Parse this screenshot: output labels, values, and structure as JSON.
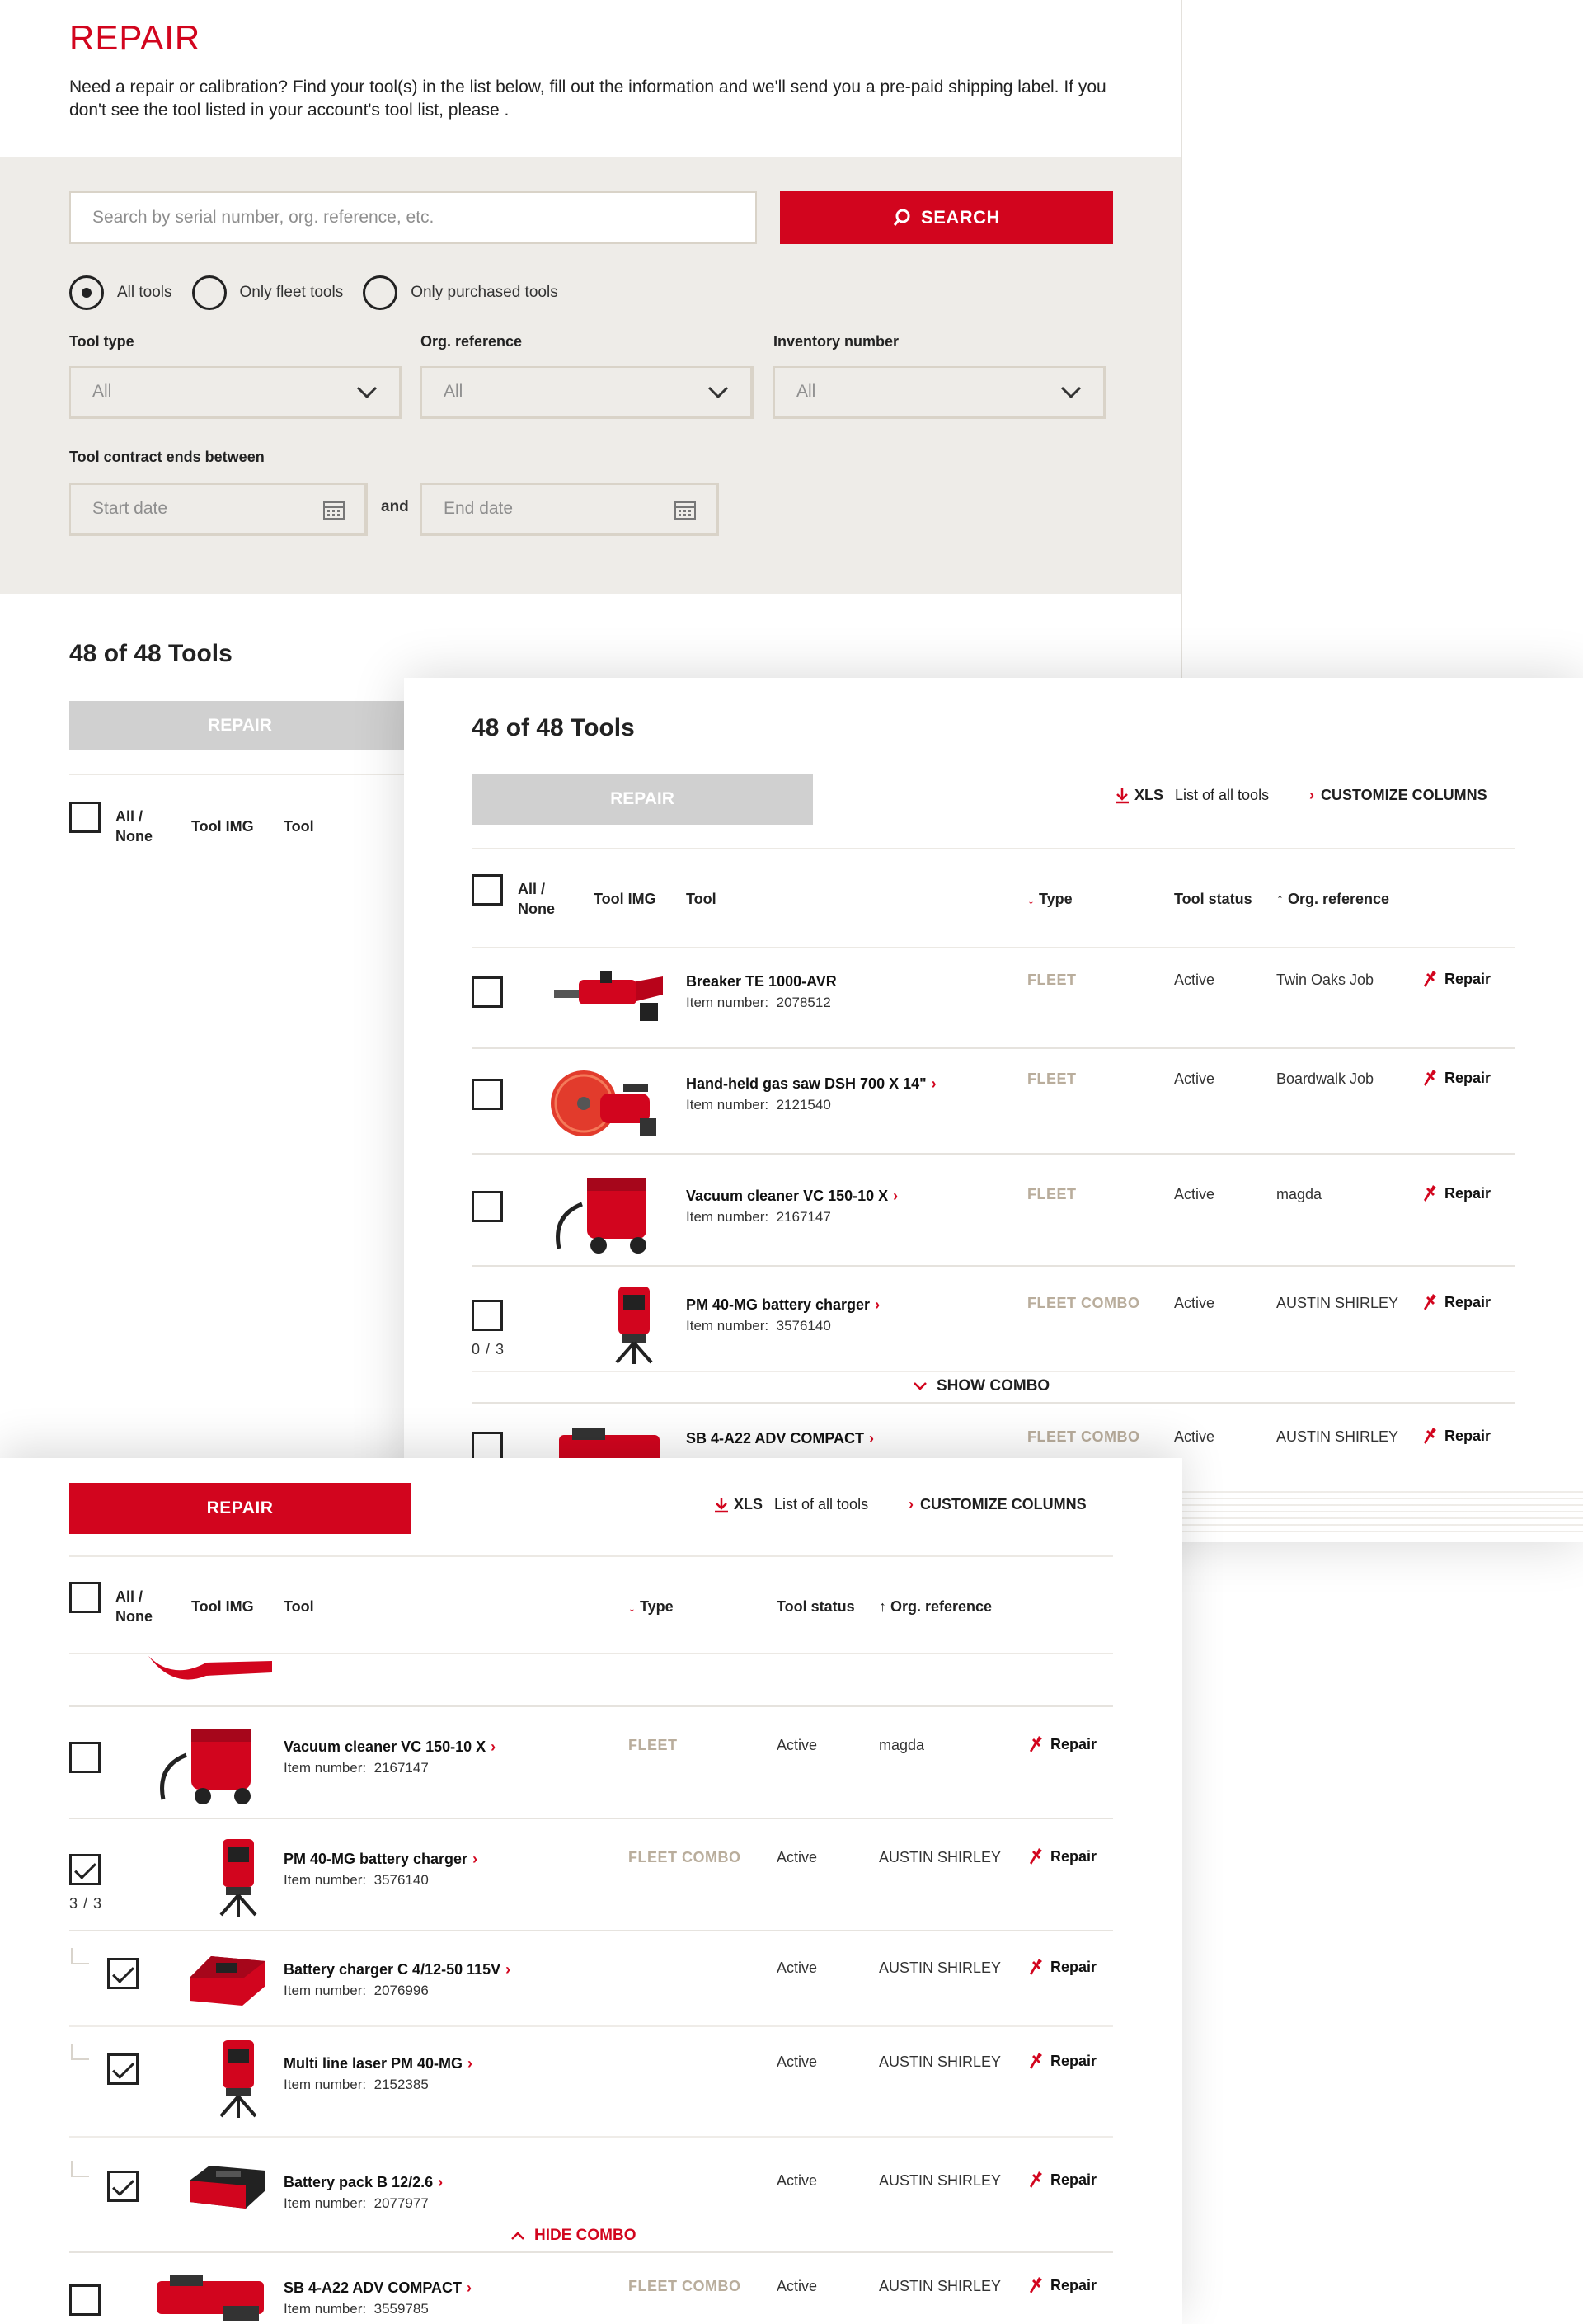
{
  "page": {
    "title": "REPAIR",
    "intro": "Need a repair or calibration? Find your tool(s) in the list below, fill out the information and we'll send you a pre-paid shipping label. If you don't see the tool listed in your account's tool list, please ."
  },
  "search": {
    "placeholder": "Search by serial number, org. reference, etc.",
    "button": "SEARCH"
  },
  "radios": [
    "All tools",
    "Only fleet tools",
    "Only purchased tools"
  ],
  "filters": {
    "tool_type": {
      "label": "Tool type",
      "value": "All"
    },
    "org_reference": {
      "label": "Org. reference",
      "value": "All"
    },
    "inventory_number": {
      "label": "Inventory number",
      "value": "All"
    },
    "contract": {
      "label": "Tool contract ends between",
      "start_placeholder": "Start date",
      "and": "and",
      "end_placeholder": "End date"
    }
  },
  "results": {
    "count": "48 of 48 Tools",
    "repair_button": "REPAIR"
  },
  "toolbar": {
    "xls": "XLS",
    "list_all": "List of all tools",
    "customize": "CUSTOMIZE COLUMNS"
  },
  "table": {
    "headers": {
      "all_none_1": "All /",
      "all_none_2": "None",
      "tool_img": "Tool IMG",
      "tool": "Tool",
      "type": "Type",
      "status": "Tool status",
      "org": "Org. reference"
    },
    "item_label": "Item number:",
    "repair_label": "Repair"
  },
  "panelB_rows": [
    {
      "name": "Breaker TE 1000-AVR",
      "item": "2078512",
      "type": "FLEET",
      "status": "Active",
      "org": "Twin Oaks Job",
      "link": false
    },
    {
      "name": "Hand-held gas saw DSH 700 X 14\"",
      "item": "2121540",
      "type": "FLEET",
      "status": "Active",
      "org": "Boardwalk Job",
      "link": true
    },
    {
      "name": "Vacuum cleaner VC 150-10 X",
      "item": "2167147",
      "type": "FLEET",
      "status": "Active",
      "org": "magda",
      "link": true
    },
    {
      "name": "PM 40-MG battery charger",
      "item": "3576140",
      "type": "FLEET COMBO",
      "status": "Active",
      "org": "AUSTIN SHIRLEY",
      "link": true,
      "combo": "0 / 3"
    },
    {
      "name": "SB 4-A22 ADV COMPACT",
      "item": "",
      "type": "FLEET COMBO",
      "status": "Active",
      "org": "AUSTIN SHIRLEY",
      "link": true
    }
  ],
  "panelB_show_combo": "SHOW COMBO",
  "panelC_rows": [
    {
      "name": "Vacuum cleaner VC 150-10 X",
      "item": "2167147",
      "type": "FLEET",
      "status": "Active",
      "org": "magda"
    },
    {
      "name": "PM 40-MG battery charger",
      "item": "3576140",
      "type": "FLEET COMBO",
      "status": "Active",
      "org": "AUSTIN SHIRLEY",
      "combo": "3 / 3"
    },
    {
      "name": "Battery charger C 4/12-50 115V",
      "item": "2076996",
      "type": "",
      "status": "Active",
      "org": "AUSTIN SHIRLEY"
    },
    {
      "name": "Multi line laser PM 40-MG",
      "item": "2152385",
      "type": "",
      "status": "Active",
      "org": "AUSTIN SHIRLEY"
    },
    {
      "name": "Battery pack B 12/2.6",
      "item": "2077977",
      "type": "",
      "status": "Active",
      "org": "AUSTIN SHIRLEY"
    },
    {
      "name": "SB 4-A22 ADV COMPACT",
      "item": "3559785",
      "type": "FLEET COMBO",
      "status": "Active",
      "org": "AUSTIN SHIRLEY"
    }
  ],
  "panelC_hide_combo": "HIDE COMBO",
  "colors": {
    "accent": "#d2051e",
    "filter_bg": "#eeece8",
    "type_text": "#b9ad9c"
  },
  "icons": [
    "search-icon",
    "chevron-down-icon",
    "calendar-icon",
    "download-icon",
    "wrench-icon",
    "chevron-up-icon"
  ]
}
